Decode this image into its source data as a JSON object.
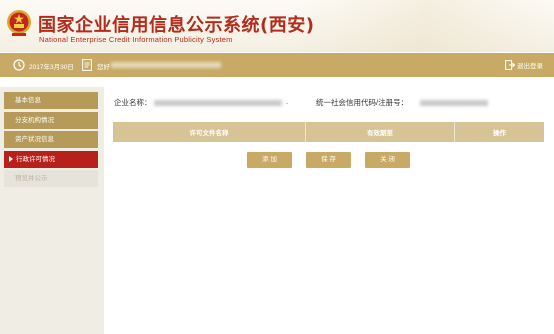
{
  "header": {
    "title_cn": "国家企业信用信息公示系统(西安)",
    "title_en": "National Enterprise Credit Information Publicity System"
  },
  "infobar": {
    "date": "2017年3月30日",
    "user_label": "您好",
    "logout_label": "退出登录",
    "icons": [
      "clock-icon",
      "document-icon",
      "logout-icon"
    ]
  },
  "sidebar": {
    "items": [
      {
        "label": "基本信息",
        "state": "normal"
      },
      {
        "label": "分支机构情况",
        "state": "normal"
      },
      {
        "label": "资产状况信息",
        "state": "normal"
      },
      {
        "label": "行政许可情况",
        "state": "active"
      },
      {
        "label": "预览并公示",
        "state": "disabled"
      }
    ]
  },
  "company": {
    "name_label": "企业名称：",
    "name_tail": ".",
    "code_label": "统一社会信用代码/注册号："
  },
  "table": {
    "headers": [
      "许可文件名称",
      "有效期至",
      "操作"
    ],
    "rows": []
  },
  "buttons": {
    "add": "添 加",
    "save": "保 存",
    "close": "关 闭"
  },
  "colors": {
    "brand_red": "#b22c1c",
    "gold": "#c8aa66",
    "menu_gold": "#b59a5a",
    "active_red": "#b8201c",
    "table_header": "#d6c497"
  }
}
